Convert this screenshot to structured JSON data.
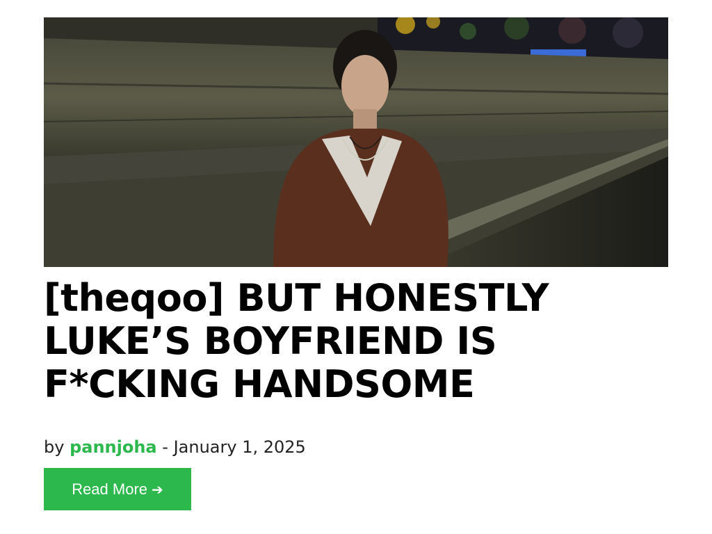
{
  "post": {
    "title": "[theqoo] BUT HONESTLY LUKE’S BOYFRIEND IS F*CKING HANDSOME",
    "by_label": "by",
    "author": "pannjoha",
    "date_separator": "-",
    "date": "January 1, 2025",
    "read_more_label": "Read More",
    "read_more_icon": "arrow-right-icon",
    "read_more_arrow": "➔"
  },
  "colors": {
    "accent": "#2db84d",
    "title": "#000000",
    "text": "#222222",
    "button_text": "#ffffff"
  }
}
